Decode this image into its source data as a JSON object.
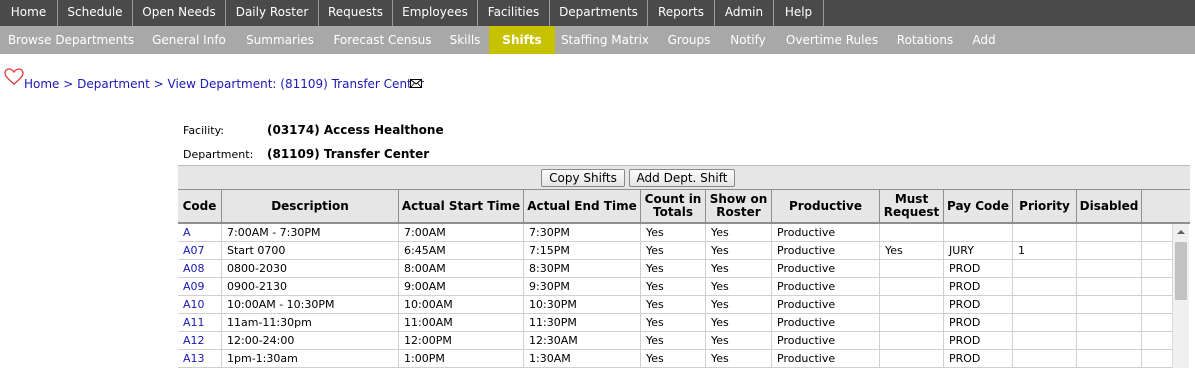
{
  "top_nav": [
    "Home",
    "Schedule",
    "Open Needs",
    "Daily Roster",
    "Requests",
    "Employees",
    "Facilities",
    "Departments",
    "Reports",
    "Admin",
    "Help"
  ],
  "sub_nav": [
    "Browse Departments",
    "General Info",
    "Summaries",
    "Forecast Census",
    "Skills",
    "Shifts",
    "Staffing Matrix",
    "Groups",
    "Notify",
    "Overtime Rules",
    "Rotations",
    "Add"
  ],
  "sub_nav_active": "Shifts",
  "breadcrumb": {
    "home": "Home",
    "department": "Department",
    "current": "View Department: (81109) Transfer Center",
    "separator": ">"
  },
  "info": {
    "facility_label": "Facility:",
    "facility_value": "(03174) Access Healthone",
    "department_label": "Department:",
    "department_value": "(81109) Transfer Center"
  },
  "toolbar": {
    "copy_shifts": "Copy Shifts",
    "add_dept_shift": "Add Dept. Shift"
  },
  "columns": [
    "Code",
    "Description",
    "Actual Start Time",
    "Actual End Time",
    "Count in Totals",
    "Show on Roster",
    "Productive",
    "Must Request",
    "Pay Code",
    "Priority",
    "Disabled"
  ],
  "rows": [
    {
      "code": "A",
      "description": "7:00AM - 7:30PM",
      "start": "7:00AM",
      "end": "7:30PM",
      "count": "Yes",
      "show": "Yes",
      "productive": "Productive",
      "must": "",
      "pay": "",
      "priority": "",
      "disabled": ""
    },
    {
      "code": "A07",
      "description": "Start 0700",
      "start": "6:45AM",
      "end": "7:15PM",
      "count": "Yes",
      "show": "Yes",
      "productive": "Productive",
      "must": "Yes",
      "pay": "JURY",
      "priority": "1",
      "disabled": ""
    },
    {
      "code": "A08",
      "description": "0800-2030",
      "start": "8:00AM",
      "end": "8:30PM",
      "count": "Yes",
      "show": "Yes",
      "productive": "Productive",
      "must": "",
      "pay": "PROD",
      "priority": "",
      "disabled": ""
    },
    {
      "code": "A09",
      "description": "0900-2130",
      "start": "9:00AM",
      "end": "9:30PM",
      "count": "Yes",
      "show": "Yes",
      "productive": "Productive",
      "must": "",
      "pay": "PROD",
      "priority": "",
      "disabled": ""
    },
    {
      "code": "A10",
      "description": "10:00AM - 10:30PM",
      "start": "10:00AM",
      "end": "10:30PM",
      "count": "Yes",
      "show": "Yes",
      "productive": "Productive",
      "must": "",
      "pay": "PROD",
      "priority": "",
      "disabled": ""
    },
    {
      "code": "A11",
      "description": "11am-11:30pm",
      "start": "11:00AM",
      "end": "11:30PM",
      "count": "Yes",
      "show": "Yes",
      "productive": "Productive",
      "must": "",
      "pay": "PROD",
      "priority": "",
      "disabled": ""
    },
    {
      "code": "A12",
      "description": "12:00-24:00",
      "start": "12:00PM",
      "end": "12:30AM",
      "count": "Yes",
      "show": "Yes",
      "productive": "Productive",
      "must": "",
      "pay": "PROD",
      "priority": "",
      "disabled": ""
    },
    {
      "code": "A13",
      "description": "1pm-1:30am",
      "start": "1:00PM",
      "end": "1:30AM",
      "count": "Yes",
      "show": "Yes",
      "productive": "Productive",
      "must": "",
      "pay": "PROD",
      "priority": "",
      "disabled": ""
    }
  ],
  "colors": {
    "top_nav_bg": "#4a4a4a",
    "sub_nav_bg": "#a8a8a8",
    "active_tab": "#c7c200",
    "link": "#1a1ab4"
  },
  "icons": {
    "logo": "heart-icon",
    "email": "envelope-icon"
  }
}
